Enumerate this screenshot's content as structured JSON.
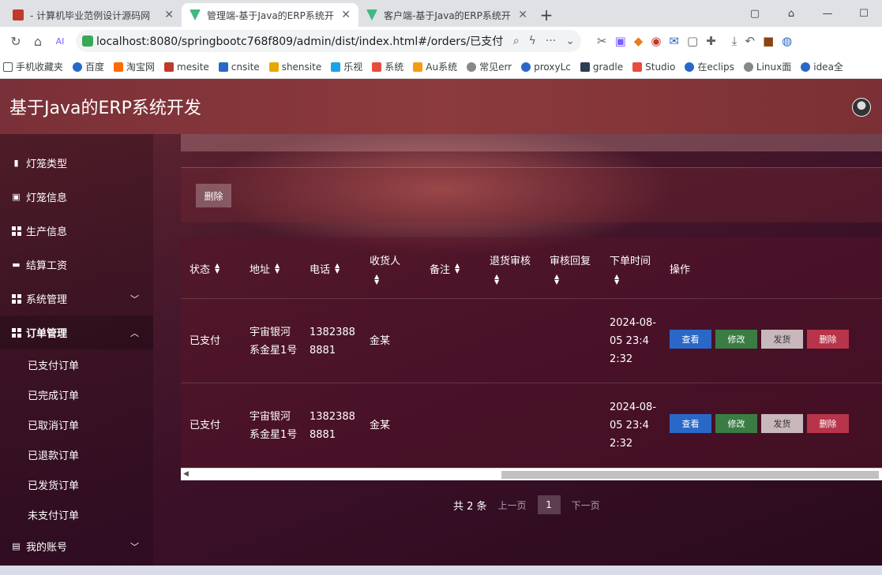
{
  "browser": {
    "tabs": [
      {
        "title": "- 计算机毕业范例设计源码网",
        "active": false
      },
      {
        "title": "管理端-基于Java的ERP系统开",
        "active": true
      },
      {
        "title": "客户端-基于Java的ERP系统开",
        "active": false
      }
    ],
    "url": "localhost:8080/springbootc768f809/admin/dist/index.html#/orders/已支付",
    "bookmarks": [
      "手机收藏夹",
      "百度",
      "淘宝网",
      "mesite",
      "cnsite",
      "shensite",
      "乐视",
      "系统",
      "Au系统",
      "常见err",
      "proxyLc",
      "gradle",
      "Studio",
      "在eclips",
      "Linux面",
      "idea全"
    ]
  },
  "header": {
    "title": "基于Java的ERP系统开发"
  },
  "sidebar": {
    "items": [
      {
        "label": "灯笼类型",
        "icon": "bar-chart-icon"
      },
      {
        "label": "灯笼信息",
        "icon": "clipboard-icon"
      },
      {
        "label": "生产信息",
        "icon": "grid-icon"
      },
      {
        "label": "结算工资",
        "icon": "ticket-icon"
      },
      {
        "label": "系统管理",
        "icon": "grid-icon"
      },
      {
        "label": "订单管理",
        "icon": "grid-icon"
      },
      {
        "label": "我的账号",
        "icon": "card-icon"
      }
    ],
    "order_sub": [
      "已支付订单",
      "已完成订单",
      "已取消订单",
      "已退款订单",
      "已发货订单",
      "未支付订单"
    ]
  },
  "toolbar": {
    "delete_label": "删除"
  },
  "table": {
    "headers": {
      "status": "状态",
      "address": "地址",
      "phone": "电话",
      "receiver": "收货人",
      "remark": "备注",
      "return_review": "退货审核",
      "review_reply": "审核回复",
      "order_time": "下单时间",
      "ops": "操作"
    },
    "rows": [
      {
        "status": "已支付",
        "address": "宇宙银河系金星1号",
        "phone": "13823888881",
        "receiver": "金某",
        "remark": "",
        "return_review": "",
        "review_reply": "",
        "order_time": "2024-08-05 23:42:32"
      },
      {
        "status": "已支付",
        "address": "宇宙银河系金星1号",
        "phone": "13823888881",
        "receiver": "金某",
        "remark": "",
        "return_review": "",
        "review_reply": "",
        "order_time": "2024-08-05 23:42:32"
      }
    ],
    "actions": {
      "view": "查看",
      "edit": "修改",
      "ship": "发货",
      "delete": "删除"
    }
  },
  "pager": {
    "total": "共 2 条",
    "prev": "上一页",
    "page": "1",
    "next": "下一页"
  },
  "colors": {
    "view": "#2a68c8",
    "edit": "#3a7d44",
    "ship": "#c8b8bc",
    "delete": "#b8344a"
  }
}
